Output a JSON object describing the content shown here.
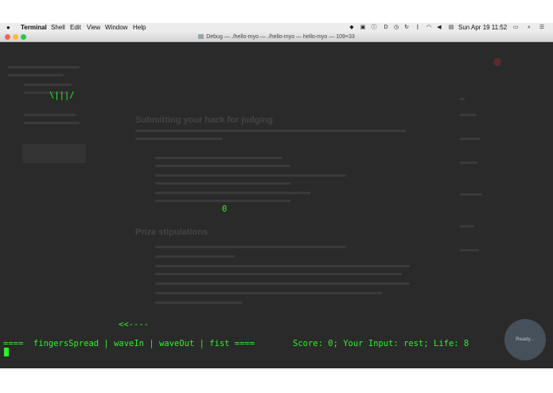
{
  "menubar": {
    "apple": "",
    "app_name": "Terminal",
    "items": [
      "Shell",
      "Edit",
      "View",
      "Window",
      "Help"
    ],
    "clock": "Sun Apr 19  11:52",
    "icons": [
      "dropbox-icon",
      "tray-icon",
      "info-icon",
      "d-icon",
      "clock-icon",
      "refresh-icon",
      "bluetooth-icon",
      "wifi-icon",
      "volume-icon",
      "flag-icon",
      "battery-icon",
      "search-icon",
      "list-icon"
    ]
  },
  "window": {
    "title": "Debug — ./hello-myo — ./hello-myo — hello-myo — 109×33",
    "traffic_colors": [
      "#fc5f57",
      "#fdbc2e",
      "#28c840"
    ]
  },
  "terminal": {
    "myo_art": "\\|||/",
    "zero": "0",
    "arrow": "<<----",
    "gesture_bar": "====  fingersSpread | waveIn | waveOut | fist ====",
    "status": "Score: 0; Your Input: rest; Life: 8"
  },
  "ready_badge": {
    "label": "Ready..."
  },
  "background_page": {
    "heading1": "Submitting your hack for judging",
    "heading2": "Prize stipulations"
  },
  "colors": {
    "terminal_green": "#2ef02e",
    "terminal_bg": "#2a2a2a"
  }
}
